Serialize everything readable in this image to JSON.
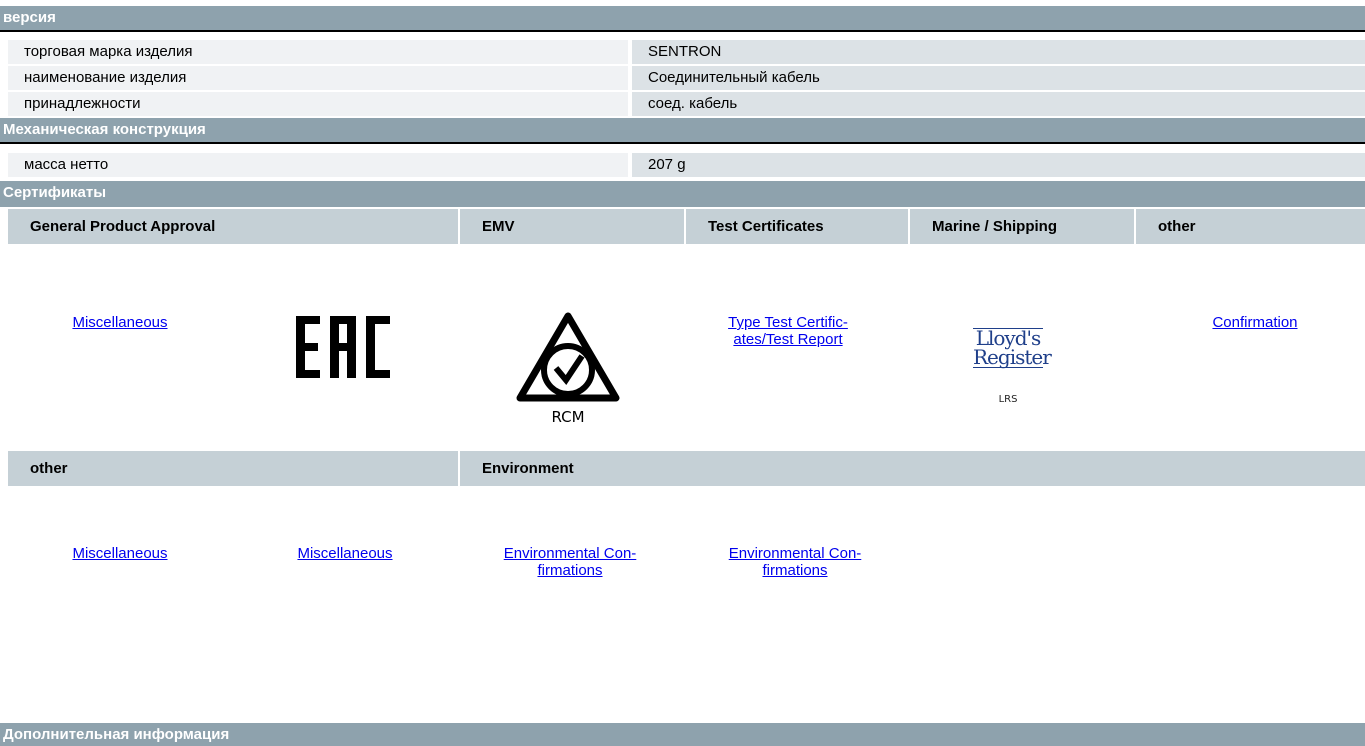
{
  "sections": {
    "version": "версия",
    "mechanical": "Механическая конструкция",
    "certificates": "Сертификаты",
    "additional": "Дополнительная информация"
  },
  "rows": [
    {
      "label": "торговая марка изделия",
      "value": "SENTRON"
    },
    {
      "label": "наименование изделия",
      "value": "Соединительный кабель"
    },
    {
      "label": "принадлежности",
      "value": "соед. кабель"
    },
    {
      "label": "масса нетто",
      "value": "207 g"
    }
  ],
  "cert_table1": {
    "headers": [
      "General Product Approval",
      "EMV",
      "Test Certificates",
      "Marine / Shipping",
      "other"
    ],
    "links": {
      "misc": "Miscellaneous",
      "type_test_line1": "Type Test Certific-",
      "type_test_line2": "ates/Test Report",
      "confirmation": "Confirmation"
    },
    "logos": {
      "eac": "EAC",
      "rcm": "RCM",
      "lloyds_line1": "Lloyd's",
      "lloyds_line2": "Register",
      "lrs": "LRS"
    }
  },
  "cert_table2": {
    "headers": [
      "other",
      "Environment"
    ],
    "links": {
      "misc1": "Miscellaneous",
      "misc2": "Miscellaneous",
      "env1_line1": "Environmental Con-",
      "env1_line2": "firmations",
      "env2_line1": "Environmental Con-",
      "env2_line2": "firmations"
    }
  },
  "colors": {
    "section_bg": "#8ea2ad",
    "header_bg": "#c5d0d6",
    "label_bg": "#f0f2f4",
    "value_bg": "#dce2e6",
    "link": "#0000ee"
  }
}
